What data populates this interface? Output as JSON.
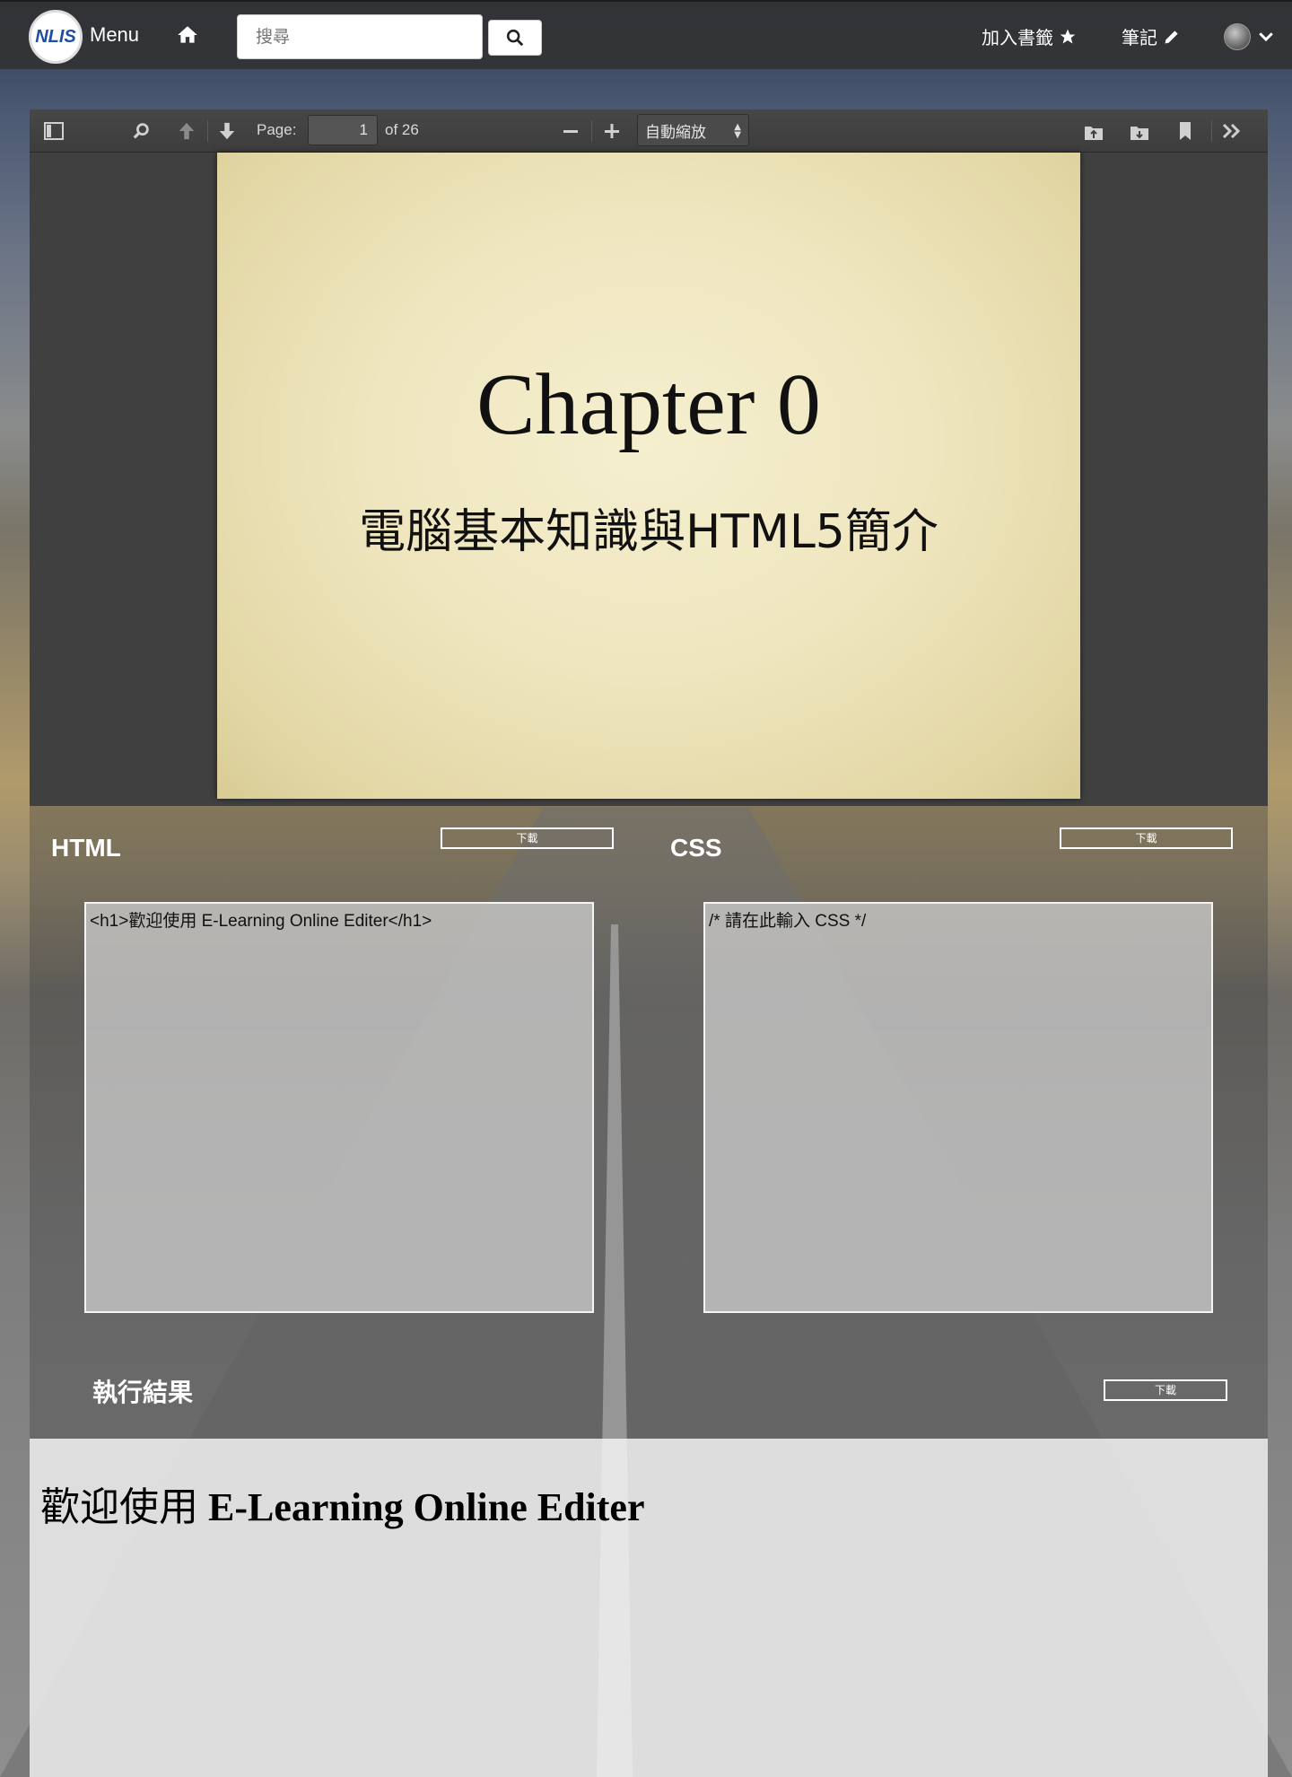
{
  "navbar": {
    "logo_text": "NLIS",
    "menu_label": "Menu",
    "search_placeholder": "搜尋",
    "bookmark_label": "加入書籤",
    "notes_label": "筆記"
  },
  "pdf_toolbar": {
    "page_label": "Page:",
    "page_value": "1",
    "page_total": "of 26",
    "zoom_value": "自動縮放"
  },
  "slide": {
    "title": "Chapter 0",
    "subtitle": "電腦基本知識與HTML5簡介"
  },
  "editor": {
    "html_title": "HTML",
    "css_title": "CSS",
    "download_label": "下載",
    "html_code": "<h1>歡迎使用 E-Learning Online Editer</h1>",
    "css_code": "/* 請在此輸入 CSS */",
    "result_title": "執行結果",
    "result_prefix": "歡迎使用 ",
    "result_bold": "E-Learning Online Editer"
  },
  "colors": {
    "navbar_bg": "#323232",
    "pdf_bg": "#404040",
    "slide_bg": "#efe6bf"
  }
}
